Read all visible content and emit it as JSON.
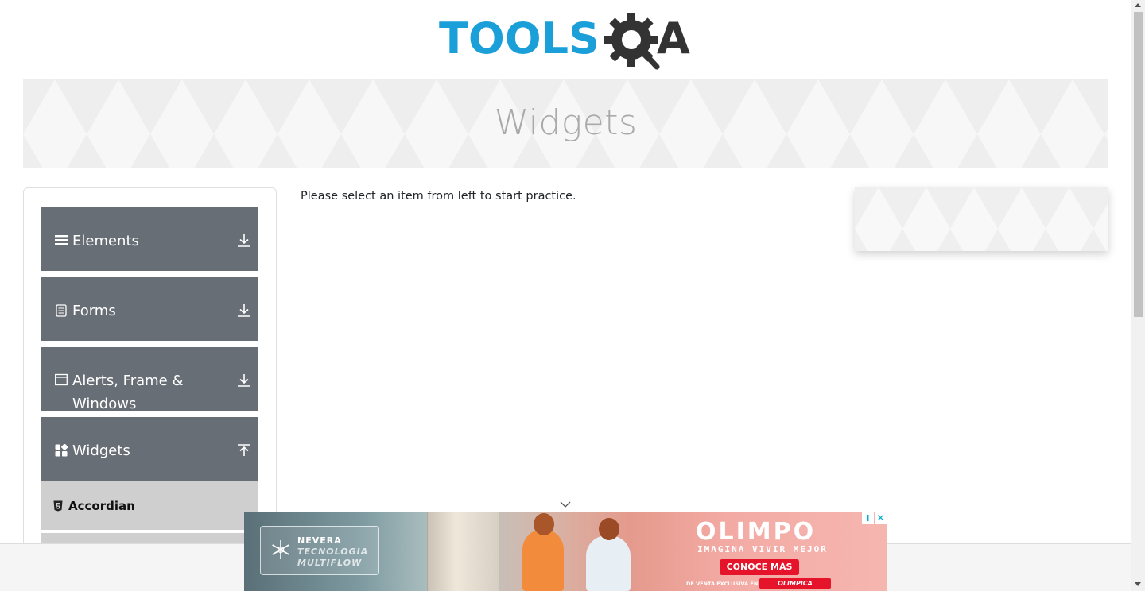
{
  "header": {
    "logo_text_tools": "TOOLS",
    "logo_text_qa": "QA"
  },
  "banner": {
    "title": "Widgets"
  },
  "sidebar": {
    "groups": [
      {
        "label": "Elements",
        "icon": "menu-icon",
        "expanded": false
      },
      {
        "label": "Forms",
        "icon": "document-icon",
        "expanded": false
      },
      {
        "label": "Alerts, Frame & Windows",
        "icon": "window-icon",
        "expanded": false
      },
      {
        "label": "Widgets",
        "icon": "widgets-icon",
        "expanded": true
      }
    ],
    "subitems": [
      {
        "label": "Accordian",
        "icon": "html5-icon"
      }
    ]
  },
  "main": {
    "message": "Please select an item from left to start practice."
  },
  "ad": {
    "line1": "NEVERA",
    "line2": "TECNOLOGÍA",
    "line3": "MULTIFLOW",
    "brand": "OLIMPO",
    "tagline": "IMAGINA VIVIR MEJOR",
    "cta": "CONOCE MÁS",
    "fine_print": "DE VENTA EXCLUSIVA EN",
    "retailer": "OLIMPICA",
    "info": "i",
    "close": "✕"
  },
  "colors": {
    "logo_blue": "#1a9fd9",
    "logo_dark": "#333333",
    "sidebar_group_bg": "#686e75",
    "subitem_bg": "#cfcfcf",
    "banner_title": "#aaaaaa",
    "cta_red": "#e5142a"
  }
}
